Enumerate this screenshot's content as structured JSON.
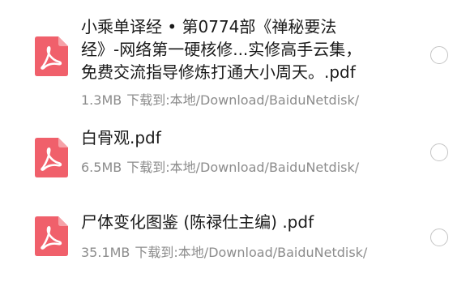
{
  "icon_colors": {
    "pdf_body": "#f0606b",
    "pdf_fold": "#f6a2a8",
    "pdf_symbol": "#ffffff"
  },
  "files": [
    {
      "icon": "pdf-file-icon",
      "name_lines": [
        "小乘单译经 • 第0774部《禅秘要法",
        "经》-网络第一硬核修...实修高手云集，",
        "免费交流指导修炼打通大小周天。.pdf"
      ],
      "size": "1.3MB",
      "location": "下载到:本地/Download/BaiduNetdisk/"
    },
    {
      "icon": "pdf-file-icon",
      "name_lines": [
        "白骨观.pdf"
      ],
      "size": "6.5MB",
      "location": "下载到:本地/Download/BaiduNetdisk/"
    },
    {
      "icon": "pdf-file-icon",
      "name_lines": [
        "尸体变化图鉴 (陈禄仕主编) .pdf"
      ],
      "size": "35.1MB",
      "location": "下载到:本地/Download/BaiduNetdisk/"
    }
  ]
}
